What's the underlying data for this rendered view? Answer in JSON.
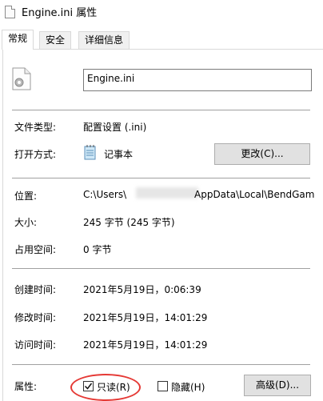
{
  "window": {
    "title": "Engine.ini 属性"
  },
  "tabs": [
    {
      "label": "常规",
      "active": true
    },
    {
      "label": "安全",
      "active": false
    },
    {
      "label": "详细信息",
      "active": false
    }
  ],
  "file": {
    "name": "Engine.ini"
  },
  "rows": {
    "type": {
      "label": "文件类型:",
      "value": "配置设置 (.ini)"
    },
    "opens_with": {
      "label": "打开方式:",
      "value": "记事本",
      "button": "更改(C)..."
    },
    "location": {
      "label": "位置:",
      "value_prefix": "C:\\Users\\",
      "value_suffix": "AppData\\Local\\BendGam"
    },
    "size": {
      "label": "大小:",
      "value": "245 字节 (245 字节)"
    },
    "disk_size": {
      "label": "占用空间:",
      "value": "0 字节"
    },
    "created": {
      "label": "创建时间:",
      "value": "2021年5月19日，0:06:39"
    },
    "modified": {
      "label": "修改时间:",
      "value": "2021年5月19日，14:01:29"
    },
    "accessed": {
      "label": "访问时间:",
      "value": "2021年5月19日，14:01:29"
    }
  },
  "attributes": {
    "label": "属性:",
    "readonly": {
      "label": "只读(R)",
      "checked": true
    },
    "hidden": {
      "label": "隐藏(H)",
      "checked": false
    },
    "advanced_button": "高级(D)..."
  },
  "colors": {
    "highlight_circle": "#e53935"
  }
}
